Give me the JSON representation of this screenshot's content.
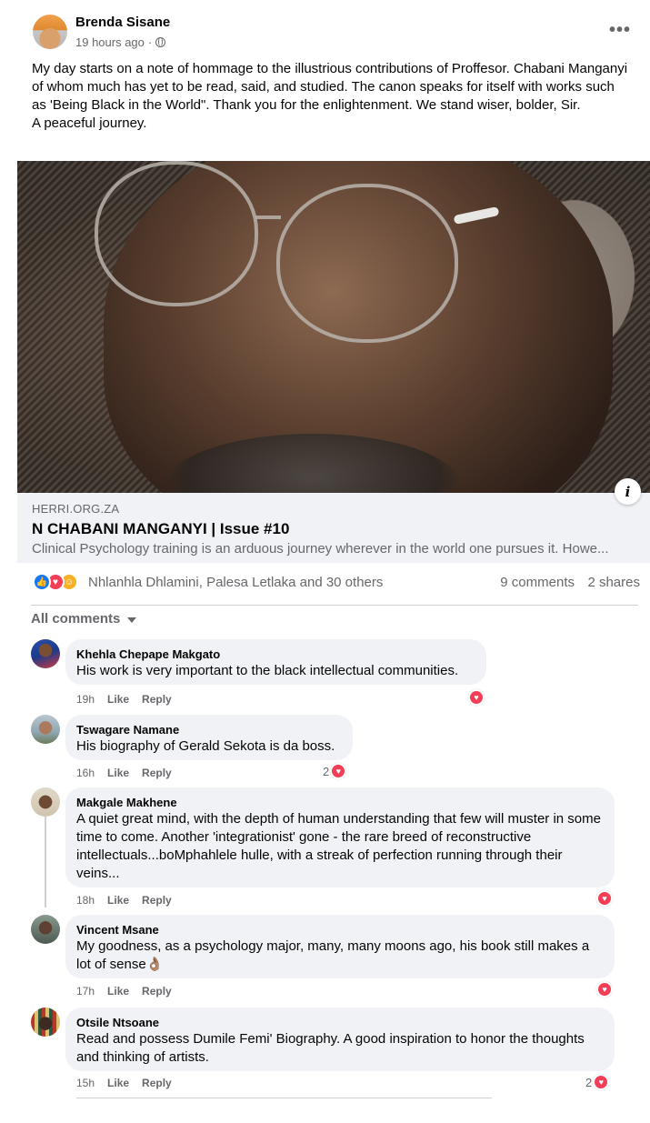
{
  "post": {
    "author": "Brenda Sisane",
    "time": "19 hours ago",
    "dot": "·",
    "more": "•••",
    "text": "My day starts on a note of hommage to the illustrious contributions of Proffesor. Chabani Manganyi of whom much has yet to be read, said, and studied. The canon speaks for itself with works such as 'Being Black in the World\". Thank you for the enlightenment.  We stand wiser, bolder, Sir.\nA peaceful journey."
  },
  "link": {
    "info": "i",
    "domain": "HERRI.ORG.ZA",
    "title": "N CHABANI MANGANYI | Issue #10",
    "description": "Clinical Psychology training is an arduous journey wherever in the world one pursues it. Howe..."
  },
  "reactions": {
    "names": "Nhlanhla Dhlamini, Palesa Letlaka and 30 others",
    "comments": "9 comments",
    "shares": "2 shares",
    "like_glyph": "👍",
    "love_glyph": "♥",
    "care_glyph": "☺"
  },
  "comments_filter": "All comments",
  "comments": [
    {
      "author": "Khehla Chepape Makgato",
      "text": "His work is very important to the black intellectual communities.",
      "time": "19h",
      "like": "Like",
      "reply": "Reply",
      "reaction_count": "",
      "heart": "♥"
    },
    {
      "author": "Tswagare Namane",
      "text": "His biography of Gerald Sekota is da boss.",
      "time": "16h",
      "like": "Like",
      "reply": "Reply",
      "reaction_count": "2",
      "heart": "♥"
    },
    {
      "author": "Makgale Makhene",
      "text": "A quiet great mind, with the depth of human understanding that few will muster in some time to come. Another 'integrationist' gone - the rare breed of reconstructive intellectuals...boMphahlele hulle, with a streak of perfection running through their veins...",
      "time": "18h",
      "like": "Like",
      "reply": "Reply",
      "reaction_count": "",
      "heart": "♥"
    },
    {
      "author": "Vincent Msane",
      "text": "My goodness, as a psychology major, many, many moons ago, his book still makes a lot of sense👌🏽",
      "time": "17h",
      "like": "Like",
      "reply": "Reply",
      "reaction_count": "",
      "heart": "♥"
    },
    {
      "author": "Otsile Ntsoane",
      "text": "Read and possess Dumile Femi' Biography. A good inspiration to honor the thoughts and thinking of artists.",
      "time": "15h",
      "like": "Like",
      "reply": "Reply",
      "reaction_count": "2",
      "heart": "♥"
    }
  ],
  "colors": {
    "text": "#050505",
    "secondary": "#65676b",
    "bubble": "#f0f2f5",
    "like_blue": "#1877f2",
    "love_red": "#f33e58",
    "care_yellow": "#f7b125"
  }
}
